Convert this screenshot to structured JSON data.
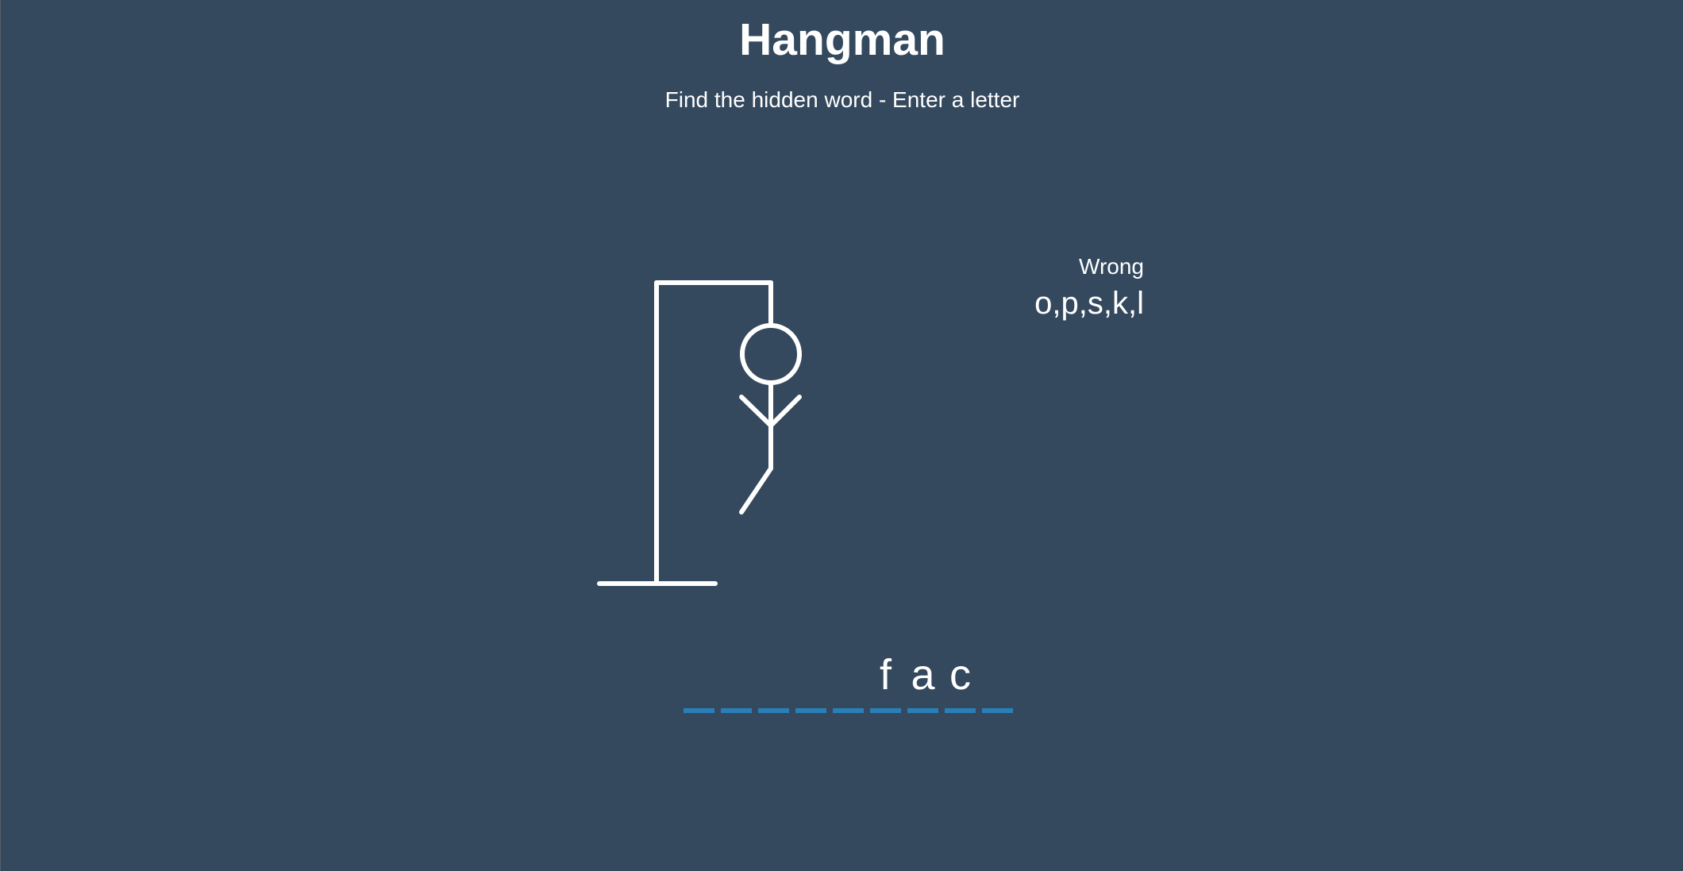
{
  "header": {
    "title": "Hangman",
    "subtitle": "Find the hidden word - Enter a letter"
  },
  "wrong": {
    "label": "Wrong",
    "letters": "o,p,s,k,l"
  },
  "word": {
    "letters": [
      "",
      "",
      "",
      "",
      "",
      "f",
      "a",
      "c",
      ""
    ]
  },
  "figure": {
    "visible_parts": [
      "head",
      "body",
      "left-arm",
      "right-arm",
      "left-leg"
    ]
  },
  "colors": {
    "background": "#34495e",
    "accent": "#2980b9",
    "foreground": "#ffffff"
  }
}
